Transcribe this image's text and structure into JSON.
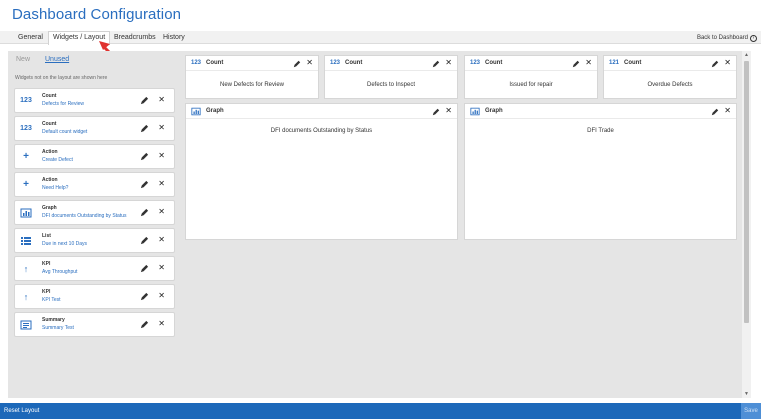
{
  "page": {
    "title": "Dashboard Configuration"
  },
  "tabs": [
    {
      "label": "General"
    },
    {
      "label": "Widgets / Layout"
    },
    {
      "label": "Breadcrumbs"
    },
    {
      "label": "History"
    }
  ],
  "back_link": {
    "label": "Back to Dashboard"
  },
  "sidebar": {
    "sub_tabs": [
      {
        "label": "New"
      },
      {
        "label": "Unused"
      }
    ],
    "hint": "Widgets not on the layout are shown here",
    "widgets": [
      {
        "icon": "count-icon",
        "glyph": "123",
        "type": "Count",
        "desc": "Defects for Review"
      },
      {
        "icon": "count-icon",
        "glyph": "123",
        "type": "Count",
        "desc": "Default count widget"
      },
      {
        "icon": "plus-icon",
        "glyph": "+",
        "type": "Action",
        "desc": "Create Defect"
      },
      {
        "icon": "plus-icon",
        "glyph": "+",
        "type": "Action",
        "desc": "Need Help?"
      },
      {
        "icon": "bar-chart-icon",
        "glyph": "",
        "type": "Graph",
        "desc": "DFI documents Outstanding by Status"
      },
      {
        "icon": "list-icon",
        "glyph": "",
        "type": "List",
        "desc": "Due in next 10 Days"
      },
      {
        "icon": "up-arrow-icon",
        "glyph": "↑",
        "type": "KPI",
        "desc": "Avg Throughput"
      },
      {
        "icon": "up-arrow-icon",
        "glyph": "↑",
        "type": "KPI",
        "desc": "KPI Test"
      },
      {
        "icon": "summary-icon",
        "glyph": "",
        "type": "Summary",
        "desc": "Summary Test"
      }
    ]
  },
  "layout": {
    "count_panels": [
      {
        "glyph": "123",
        "title": "Count",
        "body": "New Defects for Review"
      },
      {
        "glyph": "123",
        "title": "Count",
        "body": "Defects to Inspect"
      },
      {
        "glyph": "123",
        "title": "Count",
        "body": "Issued for repair"
      },
      {
        "glyph": "121",
        "title": "Count",
        "body": "Overdue Defects"
      }
    ],
    "graph_panels": [
      {
        "title": "Graph",
        "body": "DFI documents Outstanding by Status"
      },
      {
        "title": "Graph",
        "body": "DFI Trade"
      }
    ]
  },
  "footer": {
    "reset_label": "Reset Layout",
    "save_label": "Save"
  },
  "colors": {
    "accent": "#2a6ebf",
    "footer": "#1c68b9",
    "arrow": "#e0322f"
  }
}
